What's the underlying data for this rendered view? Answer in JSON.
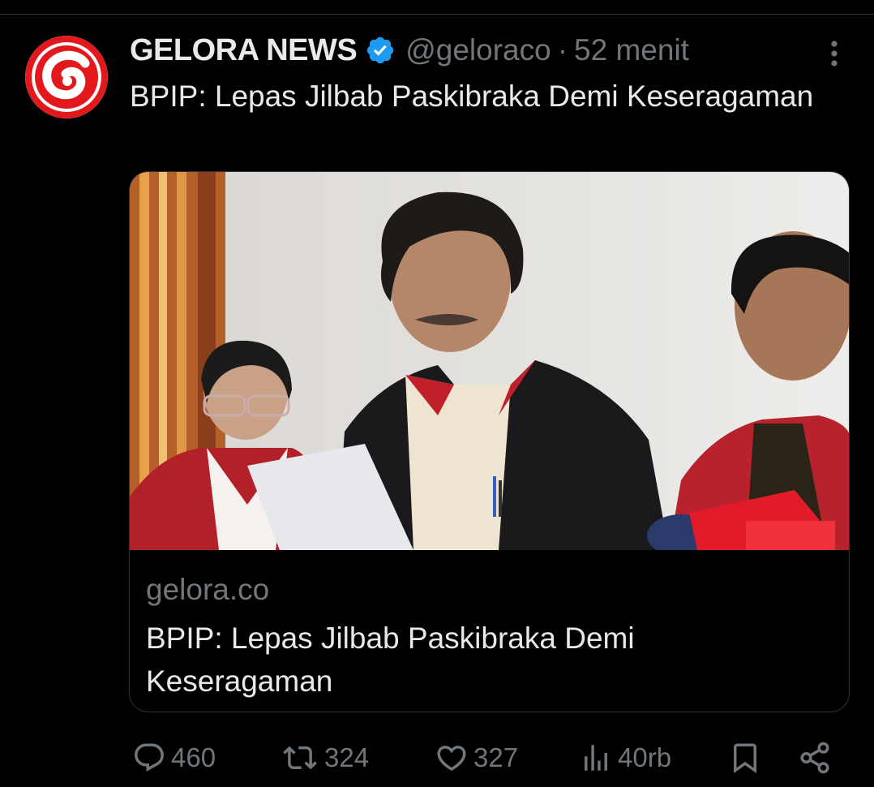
{
  "tweet": {
    "author_name": "GELORA NEWS",
    "handle": "@geloraco",
    "separator": "·",
    "time": "52 menit",
    "text": "BPIP: Lepas Jilbab Paskibraka Demi Keseragaman",
    "verified_icon": "verified-badge-icon",
    "more_icon": "more-vertical-icon"
  },
  "card": {
    "domain": "gelora.co",
    "title": "BPIP: Lepas Jilbab Paskibraka Demi Keseragaman"
  },
  "actions": {
    "replies": "460",
    "reposts": "324",
    "likes": "327",
    "views": "40rb",
    "icons": [
      "reply-icon",
      "repost-icon",
      "like-icon",
      "views-icon",
      "bookmark-icon",
      "share-icon"
    ]
  },
  "colors": {
    "background": "#000000",
    "text": "#e7e9ea",
    "muted": "#71767b",
    "verified": "#1d9bf0",
    "brand_red": "#e3181c",
    "border": "#2f3336"
  }
}
